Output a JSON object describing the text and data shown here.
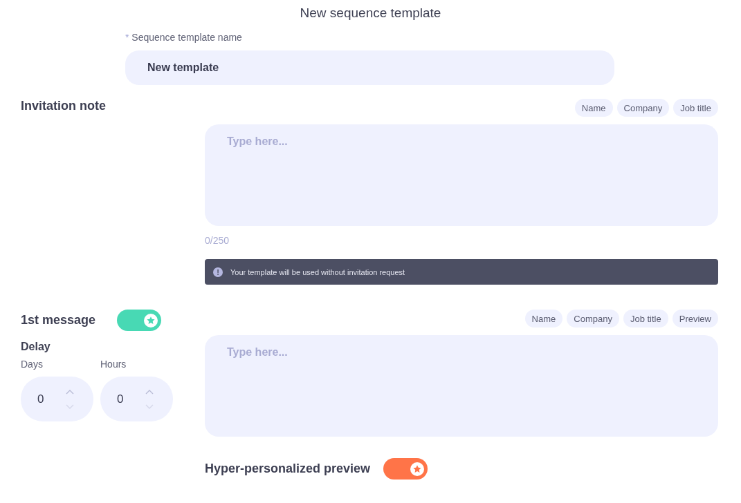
{
  "title": "New sequence template",
  "template_name": {
    "label": "Sequence template name",
    "required_mark": "*",
    "value": "New template"
  },
  "invitation_note": {
    "heading": "Invitation note",
    "chips": [
      "Name",
      "Company",
      "Job title"
    ],
    "placeholder": "Type here...",
    "counter": "0/250",
    "notice": {
      "icon": "!",
      "text": "Your template will be used without invitation request"
    }
  },
  "first_message": {
    "heading": "1st message",
    "toggle": {
      "on": true,
      "color": "#48d9b4"
    },
    "chips": [
      "Name",
      "Company",
      "Job title",
      "Preview"
    ],
    "placeholder": "Type here...",
    "delay": {
      "heading": "Delay",
      "fields": [
        {
          "label": "Days",
          "value": "0"
        },
        {
          "label": "Hours",
          "value": "0"
        }
      ]
    }
  },
  "hyper_preview": {
    "label": "Hyper-personalized preview",
    "toggle": {
      "on": true,
      "color": "#ff7448"
    }
  }
}
